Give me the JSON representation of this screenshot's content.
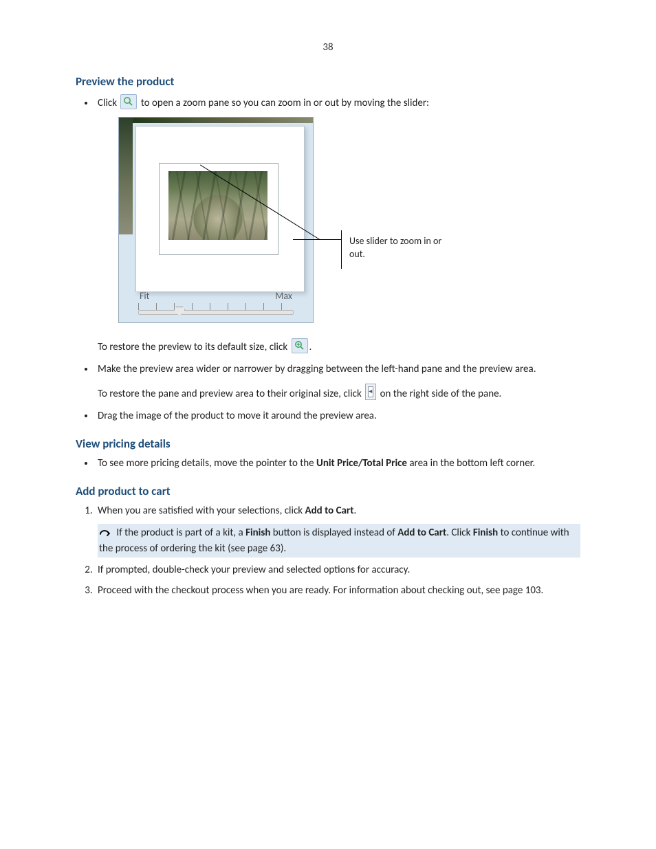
{
  "page_number": "38",
  "sections": {
    "preview": {
      "title": "Preview the product",
      "b1_a": "Click ",
      "b1_b": " to open a zoom pane so you can zoom in or out by moving the slider:",
      "slider_fit": "Fit",
      "slider_max": "Max",
      "callout": "Use slider to zoom in or out.",
      "restore_a": "To restore the preview to its default size, click ",
      "restore_b": ".",
      "b2": "Make the preview area wider or narrower by dragging between the left-hand pane and the preview area.",
      "pane_a": "To restore the pane and preview area to their original size, click ",
      "pane_b": " on the right side of the pane.",
      "b3": "Drag the image of the product to move it around the preview area."
    },
    "pricing": {
      "title": "View pricing details",
      "b1_a": "To see more pricing details, move the pointer to the ",
      "b1_bold": "Unit Price/Total Price",
      "b1_b": " area in the bottom left corner."
    },
    "cart": {
      "title": "Add product to cart",
      "s1_a": "When you are satisfied with your selections, click ",
      "s1_bold": "Add to Cart",
      "s1_b": ".",
      "note_a": " If the product is part of a kit, a ",
      "note_b1": "Finish",
      "note_c": " button is displayed instead of ",
      "note_b2": "Add to Cart",
      "note_d": ". Click ",
      "note_b3": "Finish",
      "note_e": " to continue with the process of ordering the kit (see page 63).",
      "s2": "If prompted, double-check your preview and selected options for accuracy.",
      "s3": "Proceed with the checkout process when you are ready. For information about checking out, see page 103."
    }
  }
}
